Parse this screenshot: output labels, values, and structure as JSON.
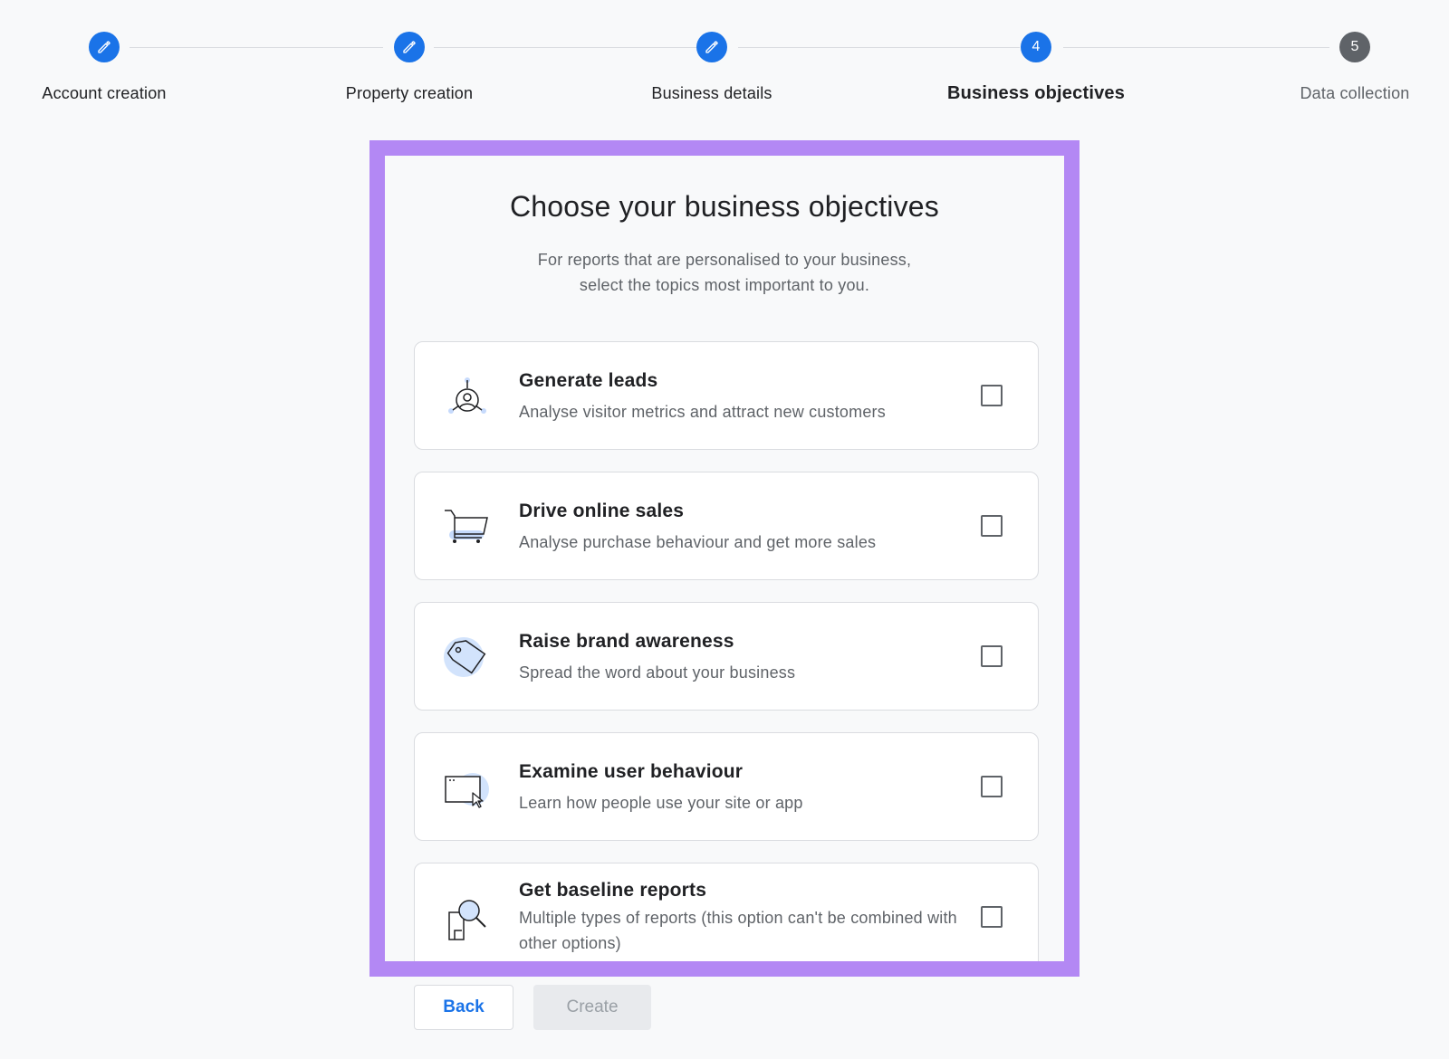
{
  "stepper": {
    "steps": [
      {
        "label": "Account creation",
        "state": "completed",
        "icon": "pencil-icon"
      },
      {
        "label": "Property creation",
        "state": "completed",
        "icon": "pencil-icon"
      },
      {
        "label": "Business details",
        "state": "completed",
        "icon": "pencil-icon"
      },
      {
        "label": "Business objectives",
        "state": "active",
        "number": "4"
      },
      {
        "label": "Data collection",
        "state": "pending",
        "number": "5"
      }
    ]
  },
  "panel": {
    "title": "Choose your business objectives",
    "subtitle_line1": "For reports that are personalised to your business,",
    "subtitle_line2": "select the topics most important to you."
  },
  "options": [
    {
      "title": "Generate leads",
      "description": "Analyse visitor metrics and attract new customers",
      "icon": "leads-icon",
      "checked": false
    },
    {
      "title": "Drive online sales",
      "description": "Analyse purchase behaviour and get more sales",
      "icon": "shopping-cart-icon",
      "checked": false
    },
    {
      "title": "Raise brand awareness",
      "description": "Spread the word about your business",
      "icon": "tag-icon",
      "checked": false
    },
    {
      "title": "Examine user behaviour",
      "description": "Learn how people use your site or app",
      "icon": "browser-cursor-icon",
      "checked": false
    },
    {
      "title": "Get baseline reports",
      "description": "Multiple types of reports (this option can't be combined with other options)",
      "icon": "report-magnifier-icon",
      "checked": false
    }
  ],
  "buttons": {
    "back": "Back",
    "create": "Create"
  },
  "colors": {
    "primary": "#1a73e8",
    "pending": "#5f6368",
    "highlight_border": "#b388f4"
  }
}
